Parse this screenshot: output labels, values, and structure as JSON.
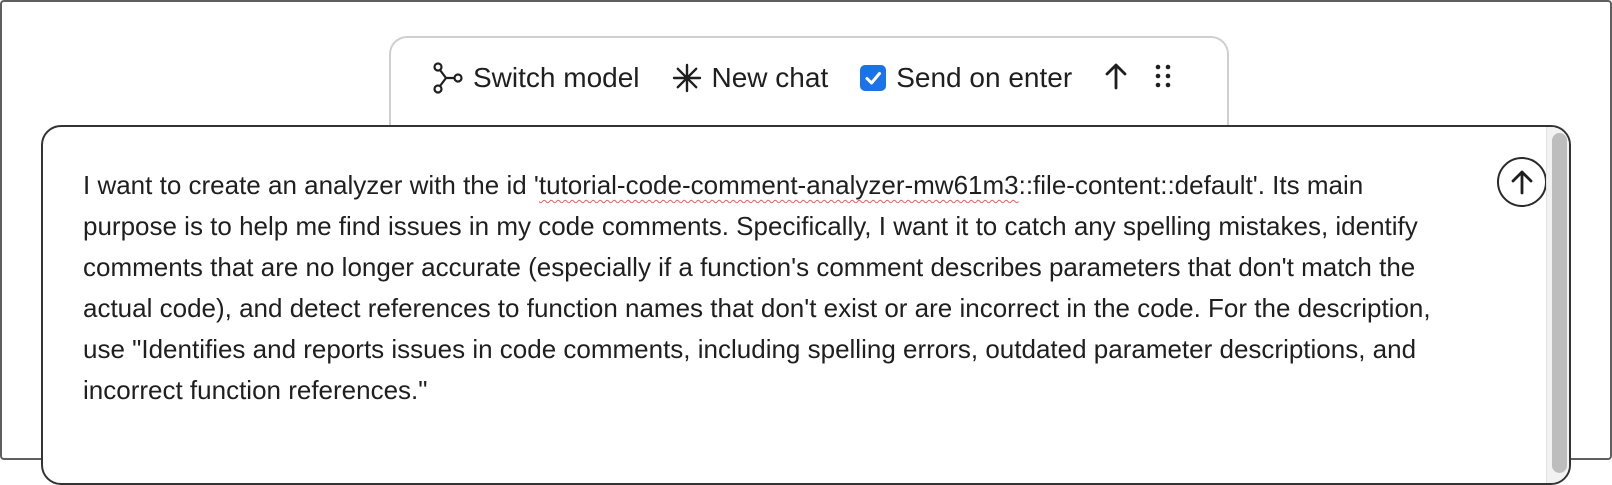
{
  "toolbar": {
    "switch_model_label": "Switch model",
    "new_chat_label": "New chat",
    "send_on_enter_label": "Send on enter",
    "send_on_enter_checked": true,
    "icons": [
      "branch-icon",
      "asterisk-icon",
      "arrow-up-icon",
      "drag-handle-icon"
    ]
  },
  "editor": {
    "text_before": "I want to create an analyzer with the id '",
    "text_misspelled": "tutorial-code-comment-analyzer-mw61m3",
    "text_after": "::file-content::default'. Its main purpose is to help me find issues in my code comments. Specifically, I want it to catch any spelling mistakes, identify comments that are no longer accurate (especially if a function's comment describes parameters that don't match the actual code), and detect references to function names that don't exist or are incorrect in the code. For the description, use \"Identifies and reports issues in code comments, including spelling errors, outdated parameter descriptions, and incorrect function references.\""
  },
  "colors": {
    "accent": "#1a73e8",
    "spellcheck": "#e06060"
  }
}
